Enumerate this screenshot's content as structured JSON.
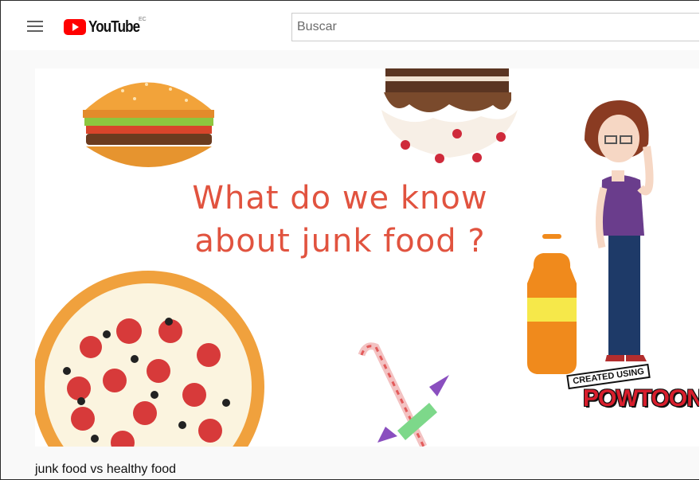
{
  "masthead": {
    "logo_text": "YouTube",
    "country_code": "EC",
    "search_placeholder": "Buscar"
  },
  "video": {
    "headline_line1": "What do we know",
    "headline_line2": "about junk food ?",
    "watermark_created": "CREATED USING",
    "watermark_brand": "POWTOON",
    "title": "junk food vs healthy food"
  },
  "colors": {
    "brand_red": "#ff0000",
    "headline": "#e1533f"
  },
  "icons": [
    "menu-icon",
    "youtube-logo-icon"
  ]
}
